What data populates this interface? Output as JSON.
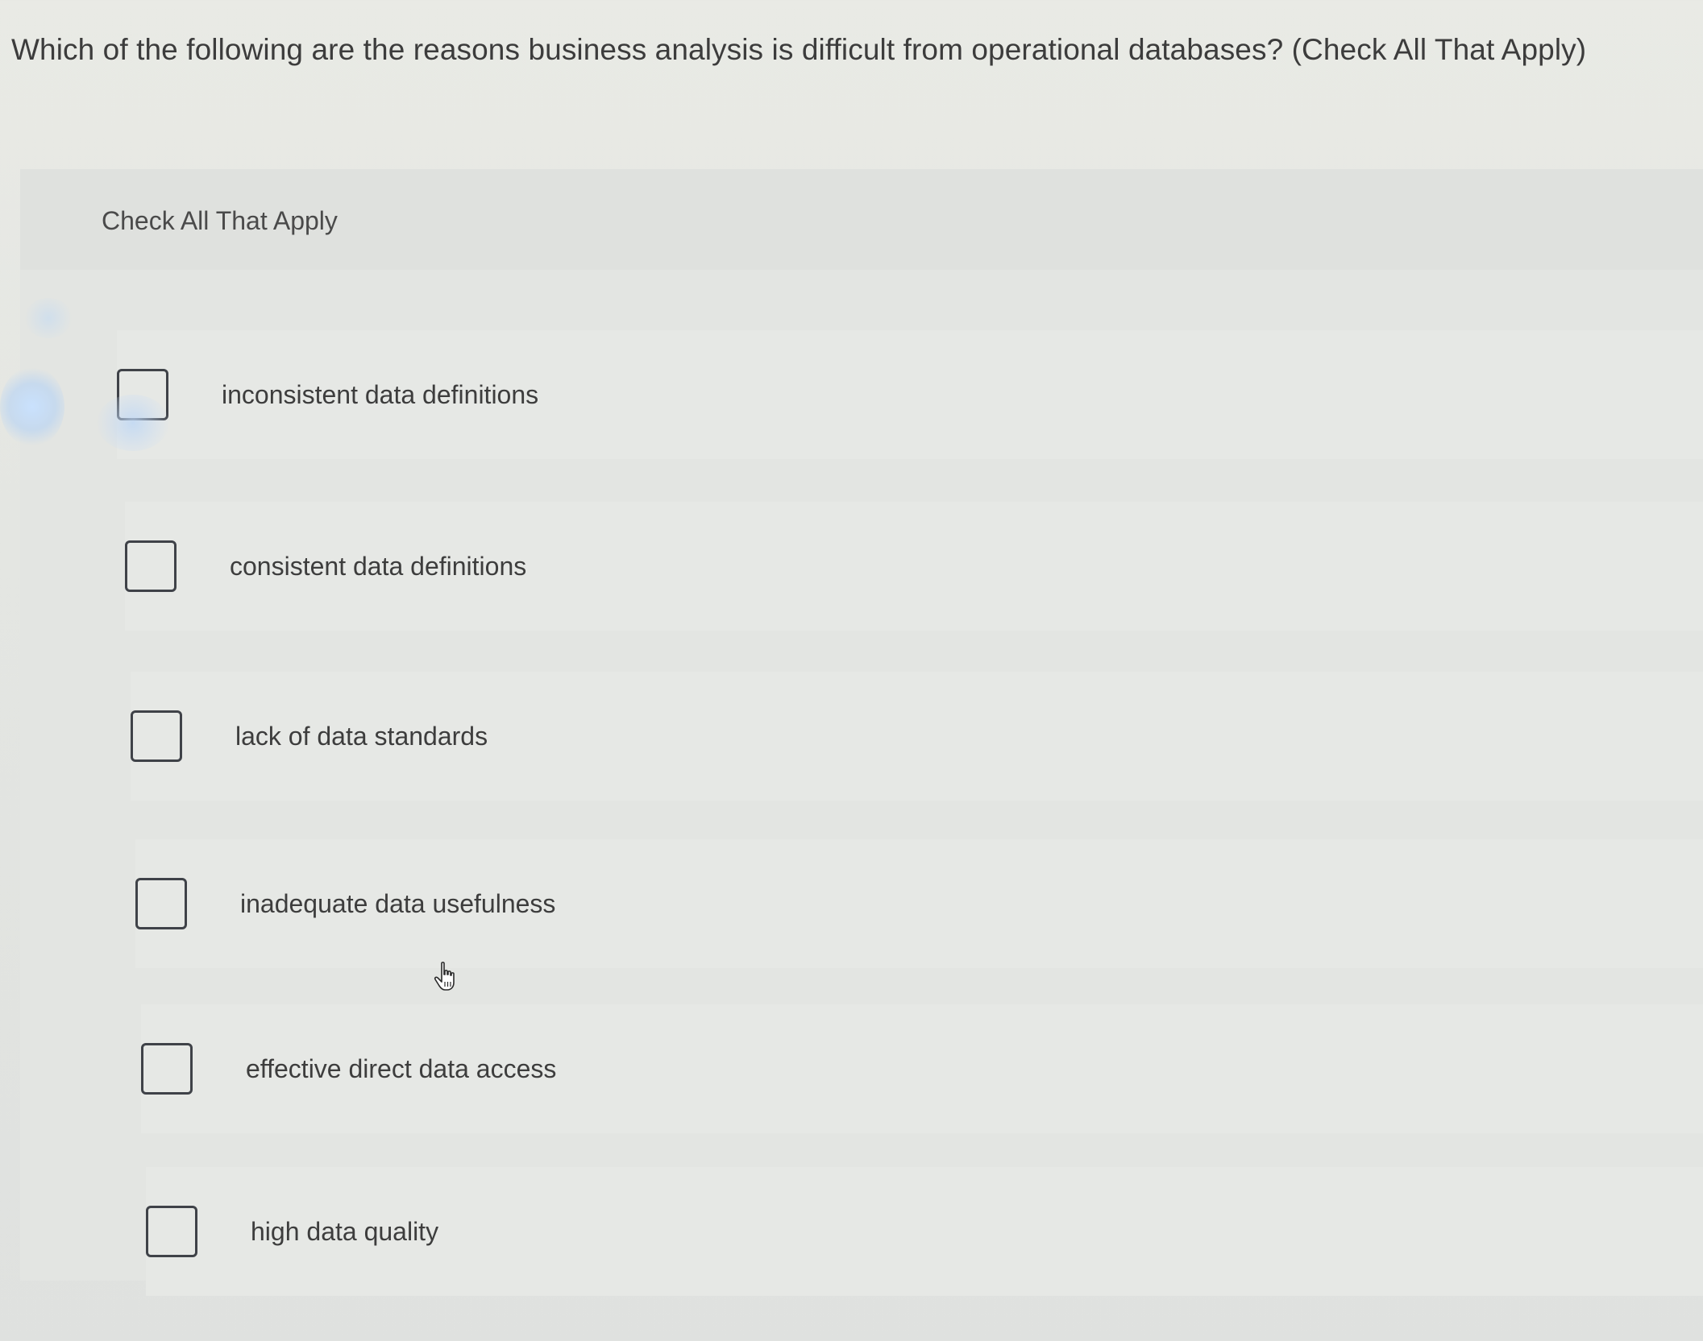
{
  "question": {
    "text": "Which of the following are the reasons business analysis is difficult from operational databases? (Check All That Apply)"
  },
  "panel": {
    "instruction": "Check All That Apply"
  },
  "options": [
    {
      "label": "inconsistent data definitions",
      "checked": false
    },
    {
      "label": "consistent data definitions",
      "checked": false
    },
    {
      "label": "lack of data standards",
      "checked": false
    },
    {
      "label": "inadequate data usefulness",
      "checked": false
    },
    {
      "label": "effective direct data access",
      "checked": false
    },
    {
      "label": "high data quality",
      "checked": false
    }
  ],
  "cursor": {
    "icon": "hand-pointer-icon"
  }
}
